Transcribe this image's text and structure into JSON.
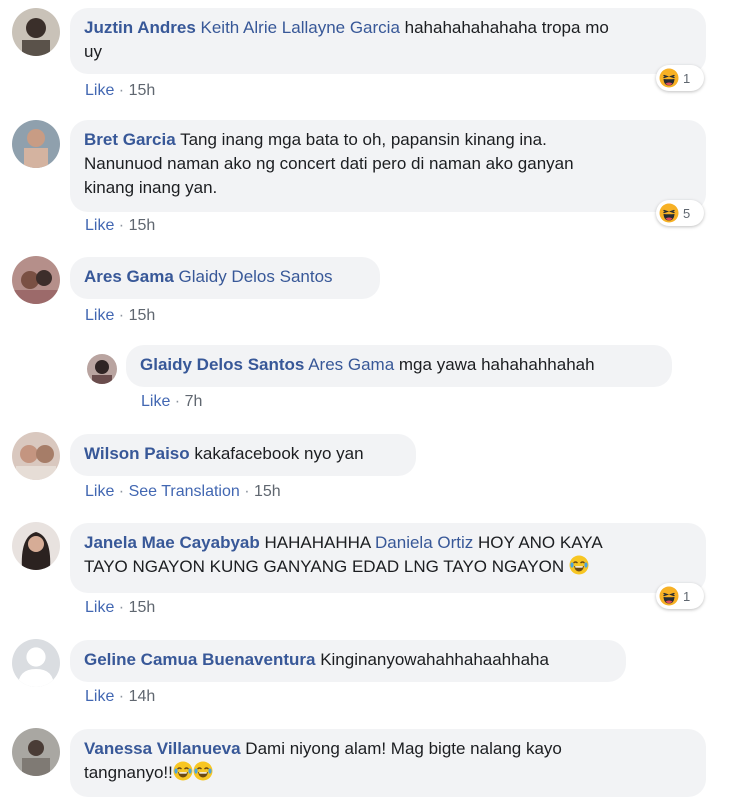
{
  "comments": [
    {
      "author": "Juztin Andres",
      "mention": "Keith Alrie Lallayne Garcia",
      "text1": " hahahahahahaha tropa mo",
      "text2": "uy",
      "like": "Like",
      "time": "15h",
      "reaction_count": "1"
    },
    {
      "author": "Bret Garcia",
      "text1": " Tang inang mga bata to oh, papansin kinang ina.",
      "text2": "Nanunuod naman ako ng concert dati pero di naman ako ganyan",
      "text3": "kinang inang yan.",
      "like": "Like",
      "time": "15h",
      "reaction_count": "5"
    },
    {
      "author": "Ares Gama",
      "mention": "Glaidy Delos Santos",
      "like": "Like",
      "time": "15h"
    },
    {
      "author": "Glaidy Delos Santos",
      "mention": "Ares Gama",
      "text1": " mga yawa hahahahhahah",
      "like": "Like",
      "time": "7h"
    },
    {
      "author": "Wilson Paiso",
      "text1": " kakafacebook nyo yan",
      "like": "Like",
      "translate": "See Translation",
      "time": "15h"
    },
    {
      "author": "Janela Mae Cayabyab",
      "text1": " HAHAHAHHA ",
      "mention": "Daniela Ortiz",
      "text2": " HOY ANO KAYA",
      "text3": "TAYO NGAYON KUNG GANYANG EDAD LNG TAYO NGAYON",
      "like": "Like",
      "time": "15h",
      "reaction_count": "1"
    },
    {
      "author": "Geline Camua Buenaventura",
      "text1": " Kinginanyowahahhahaahhaha",
      "like": "Like",
      "time": "14h"
    },
    {
      "author": "Vanessa Villanueva",
      "text1": " Dami niyong alam! Mag bigte nalang kayo",
      "text2": "tangnanyo!!"
    }
  ],
  "separator": " · ",
  "colors": {
    "link": "#385898",
    "bubble": "#f2f3f5",
    "meta": "#8d949e",
    "haha": "#f7b125"
  }
}
